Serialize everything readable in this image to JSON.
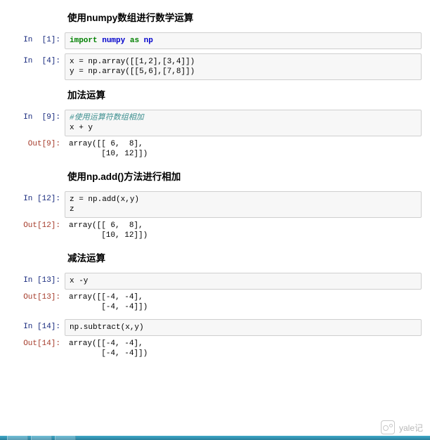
{
  "headings": {
    "h1": "使用numpy数组进行数学运算",
    "h2": "加法运算",
    "h3": "使用np.add()方法进行相加",
    "h4": "减法运算"
  },
  "cells": {
    "c1": {
      "in_prompt": "In  [1]:",
      "code_tokens": {
        "import": "import",
        "numpy": "numpy",
        "as": "as",
        "np": "np"
      }
    },
    "c4": {
      "in_prompt": "In  [4]:",
      "code": "x = np.array([[1,2],[3,4]])\ny = np.array([[5,6],[7,8]])"
    },
    "c9": {
      "in_prompt": "In  [9]:",
      "comment": "#使用运算符数组相加",
      "code": "x + y",
      "out_prompt": "Out[9]:",
      "output": "array([[ 6,  8],\n       [10, 12]])"
    },
    "c12": {
      "in_prompt": "In [12]:",
      "code": "z = np.add(x,y)\nz",
      "out_prompt": "Out[12]:",
      "output": "array([[ 6,  8],\n       [10, 12]])"
    },
    "c13": {
      "in_prompt": "In [13]:",
      "code": "x -y",
      "out_prompt": "Out[13]:",
      "output": "array([[-4, -4],\n       [-4, -4]])"
    },
    "c14": {
      "in_prompt": "In [14]:",
      "code": "np.subtract(x,y)",
      "out_prompt": "Out[14]:",
      "output": "array([[-4, -4],\n       [-4, -4]])"
    }
  },
  "watermark": {
    "text": "yale记"
  }
}
